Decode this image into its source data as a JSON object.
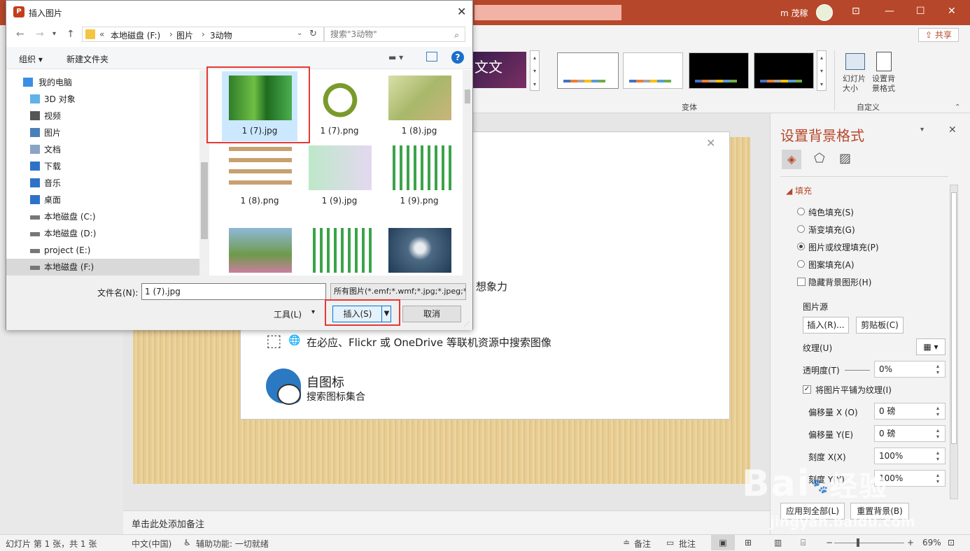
{
  "ppt": {
    "user": "m 茂稼",
    "share": "共享",
    "ribbon": {
      "theme_text": "文文",
      "variants_label": "变体",
      "slide_size": "幻灯片\n大小",
      "format_bg": "设置背\n景格式",
      "custom_label": "自定义"
    },
    "insert_panel": {
      "partial_text": "想象力",
      "bing_text": "在必应、Flickr 或 OneDrive 等联机资源中搜索图像",
      "icons_title": "自图标",
      "icons_sub": "搜索图标集合"
    },
    "notes_placeholder": "单击此处添加备注",
    "status": {
      "slide_info": "幻灯片 第 1 张，共 1 张",
      "language": "中文(中国)",
      "accessibility": "辅助功能: 一切就绪",
      "notes": "备注",
      "comments": "批注",
      "zoom": "69%"
    },
    "format_panel": {
      "title": "设置背景格式",
      "fill_section": "填充",
      "options": [
        "纯色填充(S)",
        "渐变填充(G)",
        "图片或纹理填充(P)",
        "图案填充(A)"
      ],
      "selected_option": 2,
      "hide_bg": "隐藏背景图形(H)",
      "picture_source": "图片源",
      "insert_btn": "插入(R)...",
      "clipboard_btn": "剪贴板(C)",
      "texture": "纹理(U)",
      "transparency": "透明度(T)",
      "transparency_value": "0%",
      "tile": "将图片平铺为纹理(I)",
      "offset_x": "偏移量 X (O)",
      "offset_x_value": "0 磅",
      "offset_y": "偏移量 Y(E)",
      "offset_y_value": "0 磅",
      "scale_x": "刻度 X(X)",
      "scale_x_value": "100%",
      "scale_y": "刻度 Y(Y)",
      "scale_y_value": "100%",
      "apply_all": "应用到全部(L)",
      "reset_bg": "重置背景(B)"
    }
  },
  "dialog": {
    "title": "插入图片",
    "breadcrumb": [
      "本地磁盘 (F:)",
      "图片",
      "3动物"
    ],
    "search_placeholder": "搜索\"3动物\"",
    "organize": "组织 ▾",
    "new_folder": "新建文件夹",
    "nav": [
      {
        "label": "我的电脑",
        "icon": "pc-icon"
      },
      {
        "label": "3D 对象",
        "icon": "3d-objects-icon"
      },
      {
        "label": "视频",
        "icon": "video-icon"
      },
      {
        "label": "图片",
        "icon": "pictures-icon"
      },
      {
        "label": "文档",
        "icon": "documents-icon"
      },
      {
        "label": "下载",
        "icon": "download-icon"
      },
      {
        "label": "音乐",
        "icon": "music-icon"
      },
      {
        "label": "桌面",
        "icon": "desktop-icon"
      },
      {
        "label": "本地磁盘 (C:)",
        "icon": "drive-icon"
      },
      {
        "label": "本地磁盘 (D:)",
        "icon": "drive-icon"
      },
      {
        "label": "project (E:)",
        "icon": "drive-icon"
      },
      {
        "label": "本地磁盘 (F:)",
        "icon": "drive-icon"
      }
    ],
    "files": [
      {
        "name": "1 (7).jpg",
        "kind": "bamboo-green"
      },
      {
        "name": "1 (7).png",
        "kind": "snake"
      },
      {
        "name": "1 (8).jpg",
        "kind": "bamboo-blur"
      },
      {
        "name": "1 (8).png",
        "kind": "animal-grid"
      },
      {
        "name": "1 (9).jpg",
        "kind": "bamboo-gradient"
      },
      {
        "name": "1 (9).png",
        "kind": "bamboo-cluster"
      },
      {
        "name": "",
        "kind": "bird"
      },
      {
        "name": "",
        "kind": "bamboo-cluster"
      },
      {
        "name": "",
        "kind": "owl"
      }
    ],
    "filename_label": "文件名(N):",
    "filename_value": "1 (7).jpg",
    "filetype": "所有图片(*.emf;*.wmf;*.jpg;*.jpeg;*.png)",
    "tools": "工具(L)",
    "insert": "插入(S)",
    "cancel": "取消"
  },
  "watermark": {
    "main": "Bai",
    "sub": "经验",
    "url": "jingyan.baidu.com"
  }
}
